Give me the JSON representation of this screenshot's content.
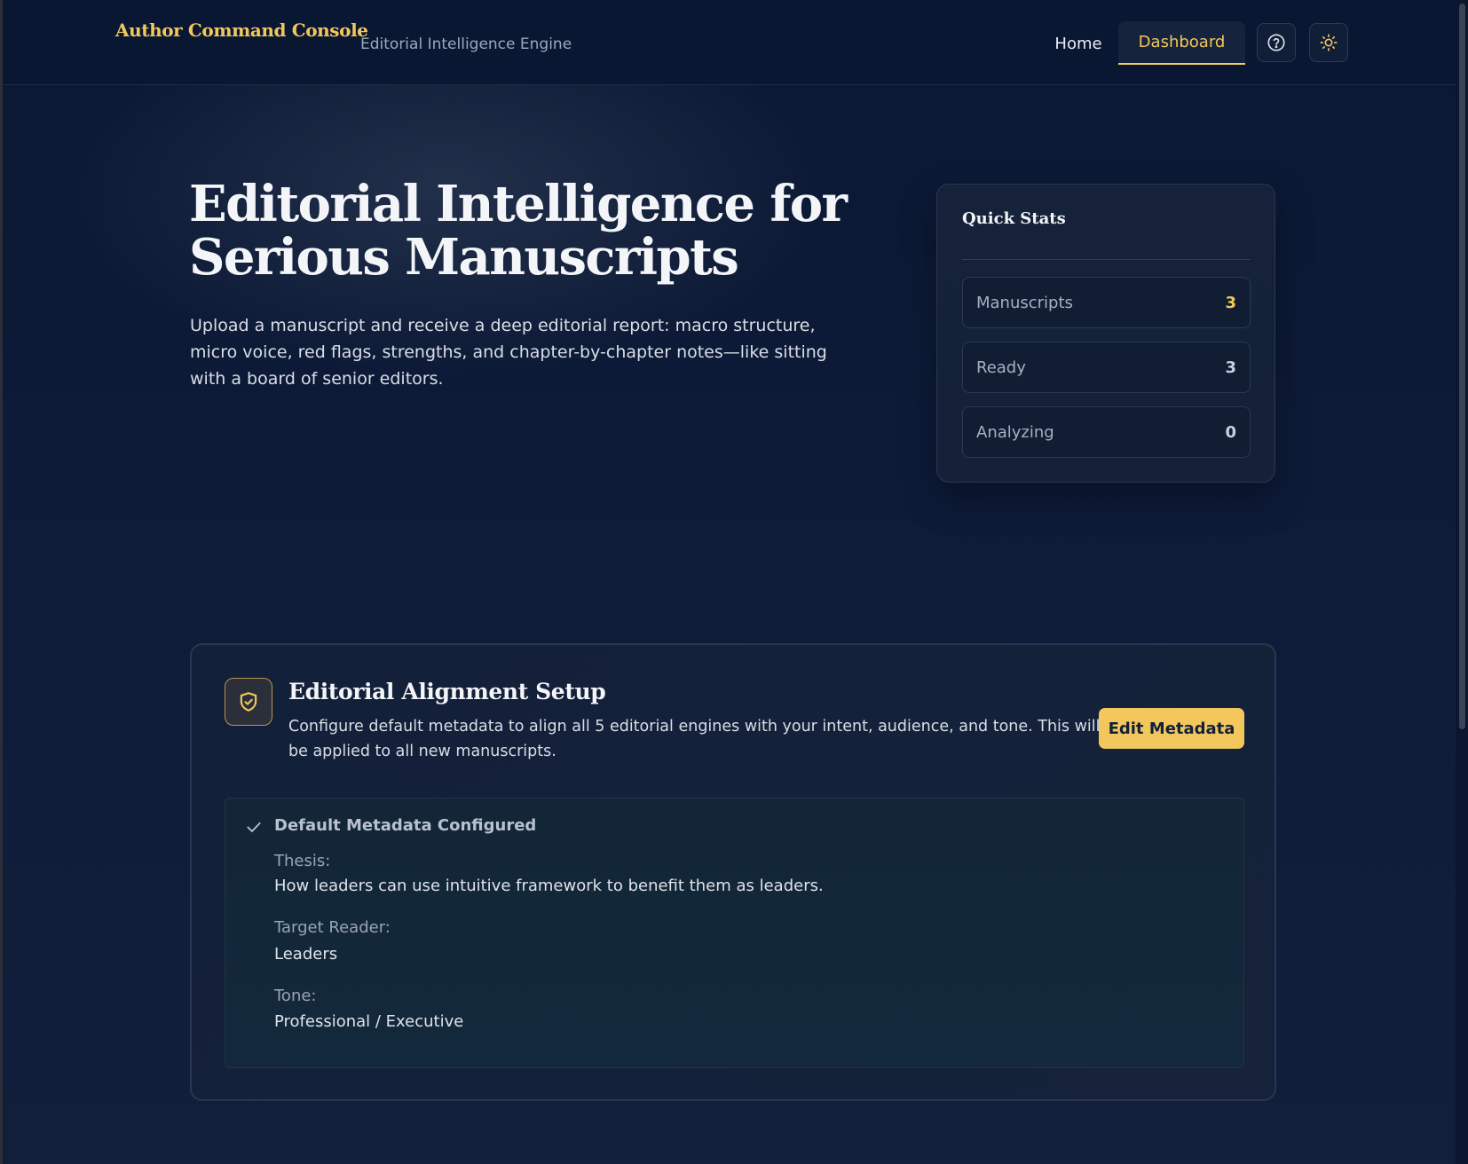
{
  "header": {
    "brand": "Author Command Console",
    "tagline": "Editorial Intelligence Engine",
    "nav": {
      "home": "Home",
      "dashboard": "Dashboard"
    },
    "active_nav": "dashboard",
    "icons": [
      "help-circle-icon",
      "sun-icon"
    ]
  },
  "hero": {
    "title": "Editorial Intelligence for Serious Manuscripts",
    "description": "Upload a manuscript and receive a deep editorial report: macro structure, micro voice, red flags, strengths, and chapter-by-chapter notes—like sitting with a board of senior editors."
  },
  "quick_stats": {
    "title": "Quick Stats",
    "rows": [
      {
        "label": "Manuscripts",
        "value": "3"
      },
      {
        "label": "Ready",
        "value": "3"
      },
      {
        "label": "Analyzing",
        "value": "0"
      }
    ]
  },
  "alignment": {
    "title": "Editorial Alignment Setup",
    "description": "Configure default metadata to align all 5 editorial engines with your intent, audience, and tone. This will be applied to all new manuscripts.",
    "edit_button": "Edit Metadata",
    "icon": "shield-check-icon",
    "metadata": {
      "heading": "Default Metadata Configured",
      "fields": [
        {
          "label": "Thesis:",
          "value": "How leaders can use intuitive framework to benefit them as leaders."
        },
        {
          "label": "Target Reader:",
          "value": "Leaders"
        },
        {
          "label": "Tone:",
          "value": "Professional / Executive"
        }
      ]
    }
  },
  "colors": {
    "background": "#0d1b36",
    "accent": "#f2c75c",
    "card": "#152239"
  }
}
